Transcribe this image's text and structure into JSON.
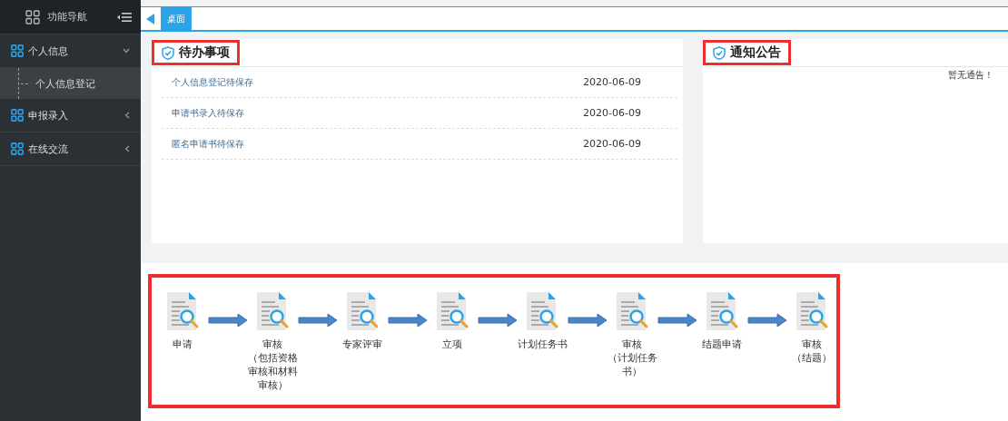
{
  "sidebar": {
    "title": "功能导航",
    "items": [
      {
        "label": "个人信息",
        "expanded": true,
        "children": [
          {
            "label": "个人信息登记",
            "selected": true
          }
        ]
      },
      {
        "label": "申报录入",
        "expanded": false
      },
      {
        "label": "在线交流",
        "expanded": false
      }
    ]
  },
  "tabs": [
    {
      "label": "桌面",
      "selected": true
    }
  ],
  "todo": {
    "title": "待办事项",
    "highlighted": true,
    "rows": [
      {
        "text": "个人信息登记待保存",
        "date": "2020-06-09"
      },
      {
        "text": "申请书录入待保存",
        "date": "2020-06-09"
      },
      {
        "text": "匿名申请书待保存",
        "date": "2020-06-09"
      }
    ]
  },
  "notice": {
    "title": "通知公告",
    "highlighted": true,
    "empty_text": "暂无通告！"
  },
  "flow": {
    "highlighted": true,
    "steps": [
      {
        "label": "申请"
      },
      {
        "label": "审核",
        "note": "（包括资格审核和材料审核）"
      },
      {
        "label": "专家评审"
      },
      {
        "label": "立项"
      },
      {
        "label": "计划任务书"
      },
      {
        "label": "审核",
        "note": "（计划任务书）"
      },
      {
        "label": "结题申请"
      },
      {
        "label": "审核",
        "note": "（结题）"
      }
    ]
  }
}
